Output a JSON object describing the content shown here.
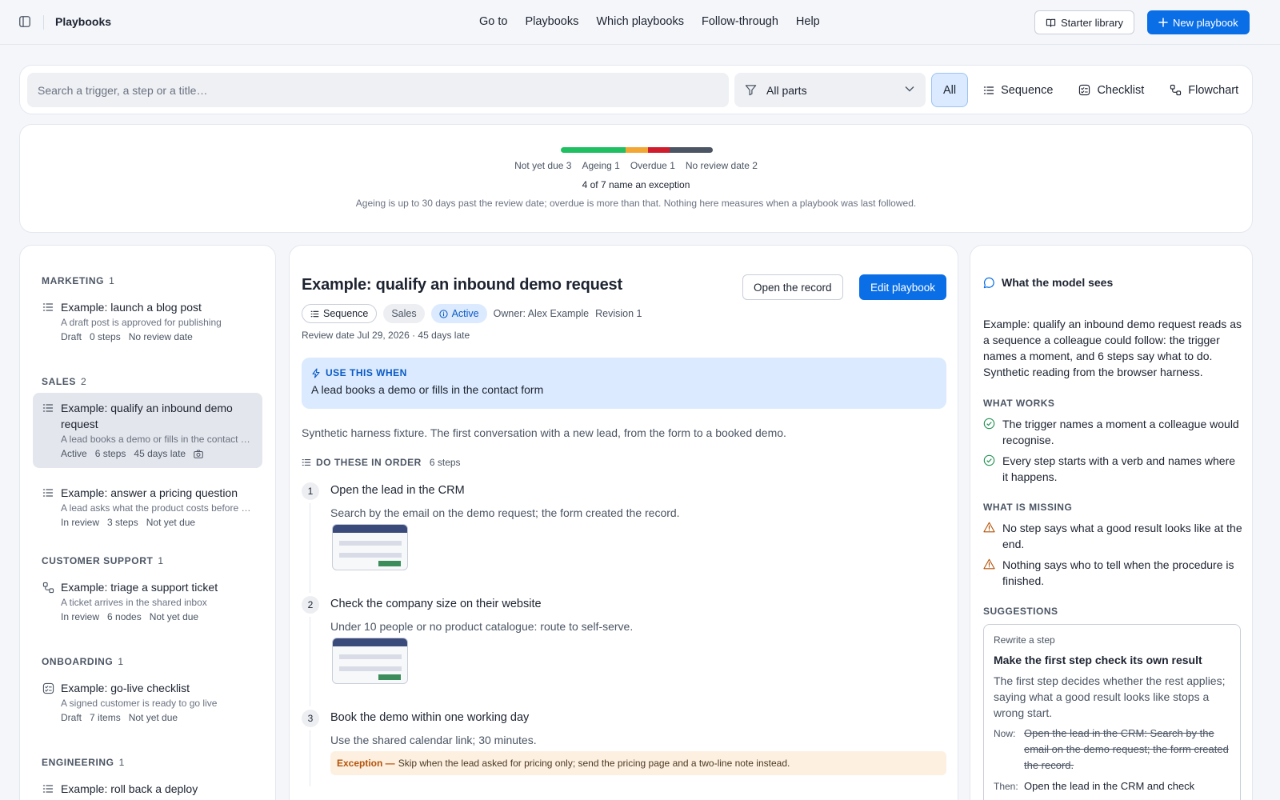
{
  "app": {
    "title": "Playbooks"
  },
  "nav": [
    "Go to",
    "Playbooks",
    "Which playbooks",
    "Follow-through",
    "Help"
  ],
  "toolbar": {
    "starter_label": "Starter library",
    "new_label": "New playbook"
  },
  "search": {
    "placeholder": "Search a trigger, a step or a title…",
    "parts_value": "All parts"
  },
  "segments": [
    {
      "label": "All",
      "icon": "none",
      "selected": true
    },
    {
      "label": "Sequence",
      "icon": "list-icon"
    },
    {
      "label": "Checklist",
      "icon": "checklist-icon"
    },
    {
      "label": "Flowchart",
      "icon": "flowchart-icon"
    }
  ],
  "stats": {
    "segments": [
      {
        "name": "Not yet due",
        "count": 3,
        "color": "#1fbf62"
      },
      {
        "name": "Ageing",
        "count": 1,
        "color": "#f2a634"
      },
      {
        "name": "Overdue",
        "count": 1,
        "color": "#cf1d2e"
      },
      {
        "name": "No review date",
        "count": 2,
        "color": "#4b5563"
      }
    ],
    "legend": [
      "Not yet due 3",
      "Ageing 1",
      "Overdue 1",
      "No review date 2"
    ],
    "exception_text": "4 of 7 name an exception",
    "note": "Ageing is up to 30 days past the review date; overdue is more than that. Nothing here measures when a playbook was last followed."
  },
  "groups": [
    {
      "name": "MARKETING",
      "count": "1",
      "items": [
        {
          "title": "Example: launch a blog post",
          "desc": "A draft post is approved for publishing",
          "meta": [
            "Draft",
            "0 steps",
            "No review date"
          ],
          "icon": "list-icon"
        }
      ]
    },
    {
      "name": "SALES",
      "count": "2",
      "items": [
        {
          "title": "Example: qualify an inbound demo request",
          "desc": "A lead books a demo or fills in the contact form",
          "meta": [
            "Active",
            "6 steps",
            "45 days late"
          ],
          "icon": "list-icon",
          "selected": true
        },
        {
          "title": "Example: answer a pricing question",
          "desc": "A lead asks what the product costs before a demo",
          "meta": [
            "In review",
            "3 steps",
            "Not yet due"
          ],
          "icon": "list-icon"
        }
      ]
    },
    {
      "name": "CUSTOMER SUPPORT",
      "count": "1",
      "items": [
        {
          "title": "Example: triage a support ticket",
          "desc": "A ticket arrives in the shared inbox",
          "meta": [
            "In review",
            "6 nodes",
            "Not yet due"
          ],
          "icon": "flowchart-icon"
        }
      ]
    },
    {
      "name": "ONBOARDING",
      "count": "1",
      "items": [
        {
          "title": "Example: go-live checklist",
          "desc": "A signed customer is ready to go live",
          "meta": [
            "Draft",
            "7 items",
            "Not yet due"
          ],
          "icon": "checklist-icon"
        }
      ]
    },
    {
      "name": "ENGINEERING",
      "count": "1",
      "items": [
        {
          "title": "Example: roll back a deploy",
          "desc": "",
          "meta": [],
          "icon": "list-icon"
        }
      ]
    }
  ],
  "playbook": {
    "title": "Example: qualify an inbound demo request",
    "open_record_label": "Open the record",
    "edit_label": "Edit playbook",
    "tag_type": "Sequence",
    "tag_team": "Sales",
    "tag_status": "Active",
    "owner": "Owner: Alex Example",
    "revision": "Revision 1",
    "review": "Review date Jul 29, 2026 · 45 days late",
    "use_when_heading": "USE THIS WHEN",
    "use_when": "A lead books a demo or fills in the contact form",
    "description": "Synthetic harness fixture. The first conversation with a new lead, from the form to a booked demo.",
    "steps_heading": "DO THESE IN ORDER",
    "steps_count": "6 steps",
    "steps": [
      {
        "num": "1",
        "title": "Open the lead in the CRM",
        "detail": "Search by the email on the demo request; the form created the record."
      },
      {
        "num": "2",
        "title": "Check the company size on their website",
        "detail": "Under 10 people or no product catalogue: route to self-serve."
      },
      {
        "num": "3",
        "title": "Book the demo within one working day",
        "detail": "Use the shared calendar link; 30 minutes.",
        "exception_label": "Exception —",
        "exception": "Skip when the lead asked for pricing only; send the pricing page and a two-line note instead."
      }
    ]
  },
  "model": {
    "heading": "What the model sees",
    "summary": "Example: qualify an inbound demo request reads as a sequence a colleague could follow: the trigger names a moment, and 6 steps say what to do. Synthetic reading from the browser harness.",
    "works_heading": "WHAT WORKS",
    "works": [
      "The trigger names a moment a colleague would recognise.",
      "Every step starts with a verb and names where it happens."
    ],
    "missing_heading": "WHAT IS MISSING",
    "missing": [
      "No step says what a good result looks like at the end.",
      "Nothing says who to tell when the procedure is finished."
    ],
    "suggestions_heading": "SUGGESTIONS",
    "suggestion": {
      "kind": "Rewrite a step",
      "title": "Make the first step check its own result",
      "body": "The first step decides whether the rest applies; saying what a good result looks like stops a wrong start.",
      "now_label": "Now:",
      "now": "Open the lead in the CRM: Search by the email on the demo request; the form created the record.",
      "then_label": "Then:",
      "then": "Open the lead in the CRM and check"
    }
  }
}
